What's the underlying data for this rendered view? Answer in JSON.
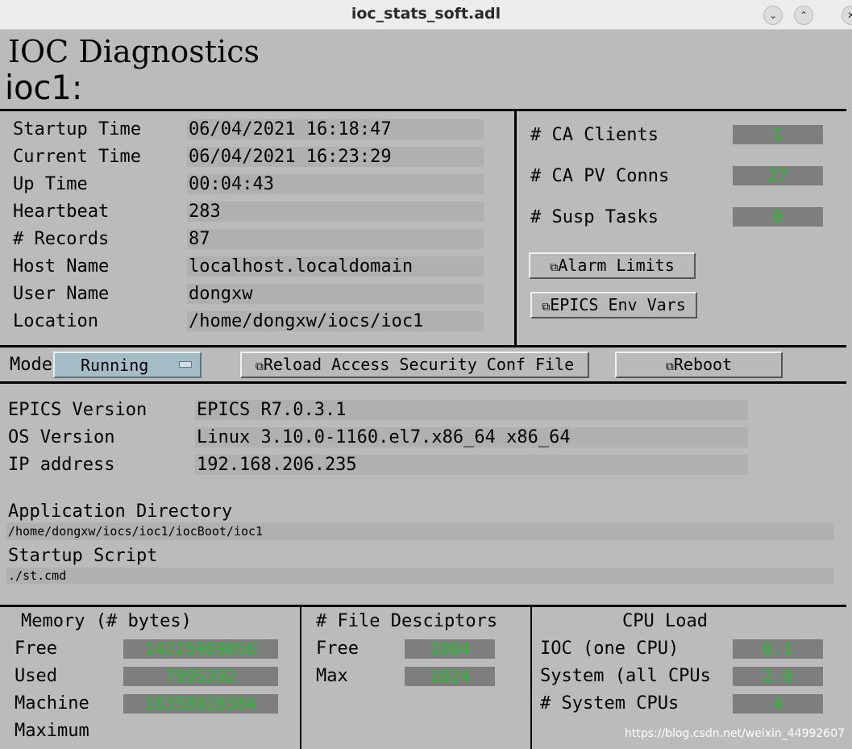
{
  "window": {
    "title": "ioc_stats_soft.adl"
  },
  "header": {
    "title": "IOC Diagnostics",
    "ioc_name": "ioc1:"
  },
  "info": {
    "rows": [
      {
        "label": "Startup Time",
        "value": "06/04/2021 16:18:47"
      },
      {
        "label": "Current Time",
        "value": "06/04/2021 16:23:29"
      },
      {
        "label": "Up Time",
        "value": "00:04:43"
      },
      {
        "label": "Heartbeat",
        "value": "283"
      },
      {
        "label": "# Records",
        "value": "87"
      },
      {
        "label": "Host Name",
        "value": "localhost.localdomain"
      },
      {
        "label": "User Name",
        "value": "dongxw"
      },
      {
        "label": "Location",
        "value": "/home/dongxw/iocs/ioc1"
      }
    ]
  },
  "ca": {
    "rows": [
      {
        "label": "# CA Clients",
        "value": "1"
      },
      {
        "label": "# CA PV Conns",
        "value": "27"
      },
      {
        "label": "# Susp Tasks",
        "value": "0"
      }
    ],
    "alarm_limits_label": "Alarm Limits",
    "epics_env_label": "EPICS Env Vars"
  },
  "controls": {
    "mode_label": "Mode",
    "mode_value": "Running",
    "reload_label": "Reload Access Security Conf File",
    "reboot_label": "Reboot"
  },
  "versions": {
    "rows": [
      {
        "label": "EPICS Version",
        "value": "EPICS R7.0.3.1"
      },
      {
        "label": "OS Version",
        "value": "Linux 3.10.0-1160.el7.x86_64 x86_64"
      },
      {
        "label": "IP address",
        "value": "192.168.206.235"
      }
    ],
    "app_dir_label": "Application Directory",
    "app_dir_value": "/home/dongxw/iocs/ioc1/iocBoot/ioc1",
    "startup_label": "Startup Script",
    "startup_value": "./st.cmd"
  },
  "memory": {
    "title": "Memory (# bytes)",
    "rows": [
      {
        "label": "Free",
        "value": "14225969056"
      },
      {
        "label": "Used",
        "value": "7995392"
      },
      {
        "label": "Machine",
        "value": "16358928384"
      },
      {
        "label": "Maximum",
        "value": ""
      }
    ]
  },
  "fd": {
    "title": "# File Desciptors",
    "rows": [
      {
        "label": "Free",
        "value": "1004"
      },
      {
        "label": "Max",
        "value": "1024"
      }
    ]
  },
  "cpu": {
    "title": "CPU Load",
    "rows": [
      {
        "label": "IOC (one CPU)",
        "value": "0.1"
      },
      {
        "label": "System (all CPUs",
        "value": "2.0"
      },
      {
        "label": "# System CPUs",
        "value": "4"
      }
    ]
  },
  "watermark": "https://blog.csdn.net/weixin_44992607",
  "colors": {
    "background": "#bbbbbb",
    "readback_green": "#22c02a",
    "menu_blue": "#a4bcc6"
  }
}
